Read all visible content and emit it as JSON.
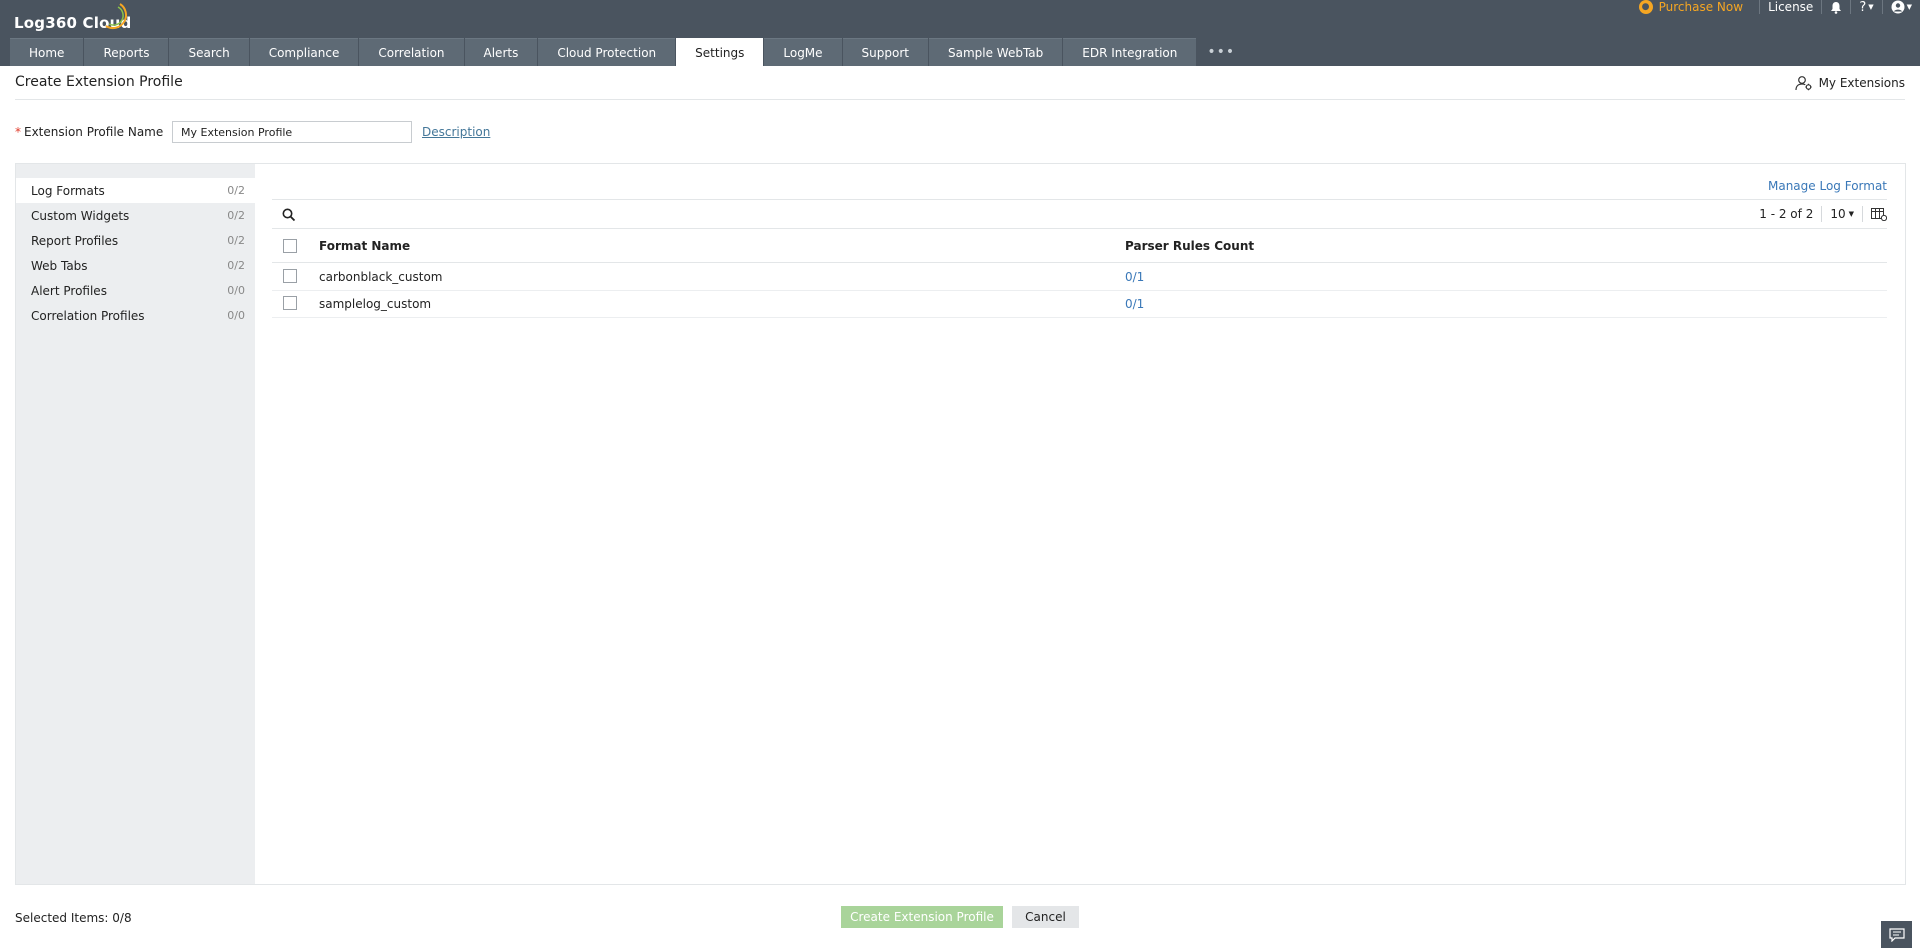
{
  "header": {
    "logo_text": "Log360 Cloud",
    "purchase_label": "Purchase Now",
    "license_label": "License",
    "help_label": "?"
  },
  "tabs": [
    {
      "label": "Home"
    },
    {
      "label": "Reports"
    },
    {
      "label": "Search"
    },
    {
      "label": "Compliance"
    },
    {
      "label": "Correlation"
    },
    {
      "label": "Alerts"
    },
    {
      "label": "Cloud Protection"
    },
    {
      "label": "Settings",
      "active": true
    },
    {
      "label": "LogMe"
    },
    {
      "label": "Support"
    },
    {
      "label": "Sample WebTab"
    },
    {
      "label": "EDR Integration"
    }
  ],
  "tabs_more": "•••",
  "page": {
    "title": "Create Extension Profile",
    "my_extensions_label": "My Extensions"
  },
  "profile_form": {
    "required_mark": "*",
    "name_label": "Extension Profile Name",
    "name_value": "My Extension Profile",
    "description_link": "Description"
  },
  "sidebar": {
    "items": [
      {
        "label": "Log Formats",
        "count": "0/2",
        "active": true
      },
      {
        "label": "Custom Widgets",
        "count": "0/2"
      },
      {
        "label": "Report Profiles",
        "count": "0/2"
      },
      {
        "label": "Web Tabs",
        "count": "0/2"
      },
      {
        "label": "Alert Profiles",
        "count": "0/0"
      },
      {
        "label": "Correlation Profiles",
        "count": "0/0"
      }
    ]
  },
  "content": {
    "manage_link": "Manage Log Format",
    "pager_range": "1 - 2 of 2",
    "page_size": "10",
    "columns": [
      "Format Name",
      "Parser Rules Count"
    ],
    "rows": [
      {
        "format_name": "carbonblack_custom",
        "parser_rules_count": "0/1"
      },
      {
        "format_name": "samplelog_custom",
        "parser_rules_count": "0/1"
      }
    ]
  },
  "footer": {
    "selected_items": "Selected Items: 0/8",
    "create_button": "Create Extension Profile",
    "cancel_button": "Cancel"
  },
  "colors": {
    "header_bg": "#4a545f",
    "tab_bg": "#5e6a75",
    "purchase_accent": "#f5a623",
    "link_blue": "#3a78b8",
    "create_button_bg": "#a9d49a"
  }
}
